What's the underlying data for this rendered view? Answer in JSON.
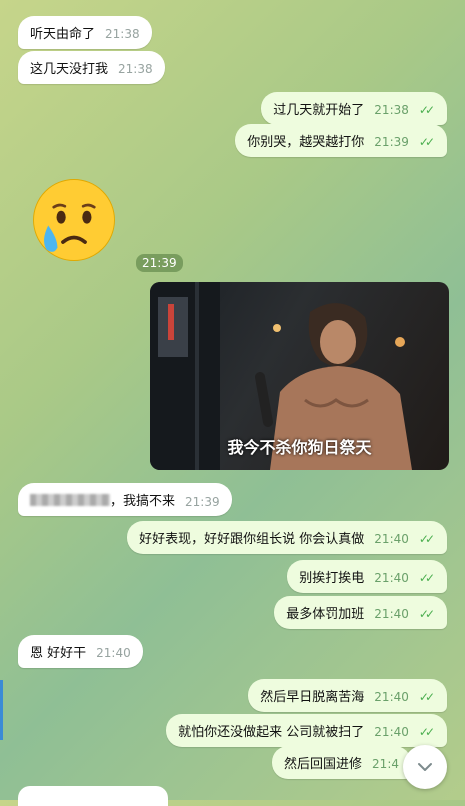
{
  "messages": [
    {
      "text": "听天由命了",
      "time": "21:38"
    },
    {
      "text": "这几天没打我",
      "time": "21:38"
    },
    {
      "text": "过几天就开始了",
      "time": "21:38"
    },
    {
      "text": "你别哭，越哭越打你",
      "time": "21:39"
    },
    {
      "time": "21:39"
    },
    {
      "caption": "我今不杀你狗日祭天"
    },
    {
      "text": "，我搞不来",
      "time": "21:39"
    },
    {
      "text": "好好表现，好好跟你组长说 你会认真做",
      "time": "21:40"
    },
    {
      "text": "别挨打挨电",
      "time": "21:40"
    },
    {
      "text": "最多体罚加班",
      "time": "21:40"
    },
    {
      "text": "恩 好好干",
      "time": "21:40"
    },
    {
      "text": "然后早日脱离苦海",
      "time": "21:40"
    },
    {
      "text": "就怕你还没做起来 公司就被扫了",
      "time": "21:40"
    },
    {
      "text": "然后回国进修",
      "time": "21:4"
    }
  ],
  "colors": {
    "incoming_bubble": "#ffffff",
    "outgoing_bubble": "#eefcde",
    "check": "#4caf50"
  },
  "icons": {
    "emoji": "crying-face-icon",
    "scroll": "chevron-down-icon"
  }
}
